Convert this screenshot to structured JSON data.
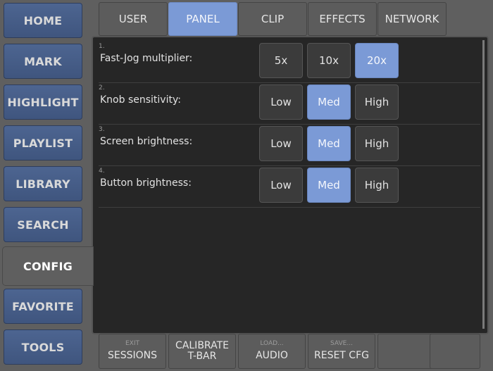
{
  "sidebar": {
    "items": [
      {
        "label": "HOME"
      },
      {
        "label": "MARK"
      },
      {
        "label": "HIGHLIGHT"
      },
      {
        "label": "PLAYLIST"
      },
      {
        "label": "LIBRARY"
      },
      {
        "label": "SEARCH"
      },
      {
        "label": "CONFIG"
      },
      {
        "label": "FAVORITE"
      },
      {
        "label": "TOOLS"
      }
    ],
    "active": "CONFIG"
  },
  "tabs": [
    {
      "label": "USER"
    },
    {
      "label": "PANEL"
    },
    {
      "label": "CLIP"
    },
    {
      "label": "EFFECTS"
    },
    {
      "label": "NETWORK"
    }
  ],
  "active_tab": "PANEL",
  "settings": [
    {
      "num": "1.",
      "label": "Fast-Jog multiplier:",
      "options": [
        "5x",
        "10x",
        "20x"
      ],
      "selected": "20x"
    },
    {
      "num": "2.",
      "label": "Knob sensitivity:",
      "options": [
        "Low",
        "Med",
        "High"
      ],
      "selected": "Med"
    },
    {
      "num": "3.",
      "label": "Screen brightness:",
      "options": [
        "Low",
        "Med",
        "High"
      ],
      "selected": "Med"
    },
    {
      "num": "4.",
      "label": "Button brightness:",
      "options": [
        "Low",
        "Med",
        "High"
      ],
      "selected": "Med"
    }
  ],
  "bottom": [
    {
      "small": "EXIT",
      "label": "SESSIONS"
    },
    {
      "small": "",
      "label1": "CALIBRATE",
      "label2": "T-BAR"
    },
    {
      "small": "LOAD...",
      "label": "AUDIO"
    },
    {
      "small": "SAVE...",
      "label": "RESET CFG"
    }
  ],
  "colors": {
    "accent": "#7b9ad6",
    "sidebar": "#4a6290",
    "panel": "#262626"
  }
}
